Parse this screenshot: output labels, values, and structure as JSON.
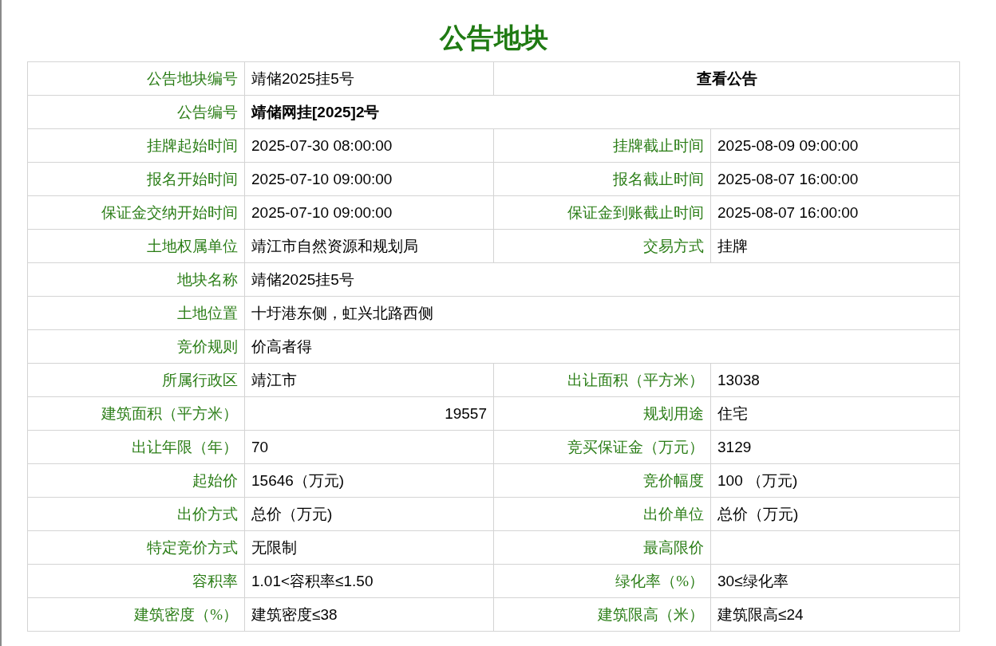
{
  "title": "公告地块",
  "rows": [
    {
      "cells": [
        {
          "kind": "label",
          "text": "公告地块编号"
        },
        {
          "kind": "value",
          "text": "靖储2025挂5号"
        },
        {
          "kind": "link",
          "text": "查看公告"
        }
      ]
    },
    {
      "cells": [
        {
          "kind": "label",
          "text": "公告编号"
        },
        {
          "kind": "value-bold-wide",
          "text": "靖储网挂[2025]2号"
        }
      ]
    },
    {
      "cells": [
        {
          "kind": "label",
          "text": "挂牌起始时间"
        },
        {
          "kind": "value",
          "text": "2025-07-30 08:00:00"
        },
        {
          "kind": "label",
          "text": "挂牌截止时间"
        },
        {
          "kind": "value",
          "text": "2025-08-09 09:00:00"
        }
      ]
    },
    {
      "cells": [
        {
          "kind": "label",
          "text": "报名开始时间"
        },
        {
          "kind": "value",
          "text": "2025-07-10 09:00:00"
        },
        {
          "kind": "label",
          "text": "报名截止时间"
        },
        {
          "kind": "value",
          "text": "2025-08-07 16:00:00"
        }
      ]
    },
    {
      "cells": [
        {
          "kind": "label",
          "text": "保证金交纳开始时间"
        },
        {
          "kind": "value",
          "text": "2025-07-10 09:00:00"
        },
        {
          "kind": "label",
          "text": "保证金到账截止时间"
        },
        {
          "kind": "value",
          "text": "2025-08-07 16:00:00"
        }
      ]
    },
    {
      "cells": [
        {
          "kind": "label",
          "text": "土地权属单位"
        },
        {
          "kind": "value",
          "text": "靖江市自然资源和规划局"
        },
        {
          "kind": "label",
          "text": "交易方式"
        },
        {
          "kind": "value",
          "text": "挂牌"
        }
      ]
    },
    {
      "cells": [
        {
          "kind": "label",
          "text": "地块名称"
        },
        {
          "kind": "value-wide",
          "text": "靖储2025挂5号"
        }
      ]
    },
    {
      "cells": [
        {
          "kind": "label",
          "text": "土地位置"
        },
        {
          "kind": "value-wide",
          "text": "十圩港东侧，虹兴北路西侧"
        }
      ]
    },
    {
      "cells": [
        {
          "kind": "label",
          "text": "竞价规则"
        },
        {
          "kind": "value-wide",
          "text": "价高者得"
        }
      ]
    },
    {
      "cells": [
        {
          "kind": "label",
          "text": "所属行政区"
        },
        {
          "kind": "value",
          "text": "靖江市"
        },
        {
          "kind": "label",
          "text": "出让面积（平方米）"
        },
        {
          "kind": "value",
          "text": "13038"
        }
      ]
    },
    {
      "cells": [
        {
          "kind": "label",
          "text": "建筑面积（平方米）"
        },
        {
          "kind": "value-right",
          "text": "19557"
        },
        {
          "kind": "label",
          "text": "规划用途"
        },
        {
          "kind": "value",
          "text": "住宅"
        }
      ]
    },
    {
      "cells": [
        {
          "kind": "label",
          "text": "出让年限（年）"
        },
        {
          "kind": "value",
          "text": "70"
        },
        {
          "kind": "label",
          "text": "竞买保证金（万元）"
        },
        {
          "kind": "value",
          "text": "3129"
        }
      ]
    },
    {
      "cells": [
        {
          "kind": "label",
          "text": "起始价"
        },
        {
          "kind": "value",
          "text": "15646（万元)"
        },
        {
          "kind": "label",
          "text": "竞价幅度"
        },
        {
          "kind": "value",
          "text": "100 （万元)"
        }
      ]
    },
    {
      "cells": [
        {
          "kind": "label",
          "text": "出价方式"
        },
        {
          "kind": "value",
          "text": "总价（万元)"
        },
        {
          "kind": "label",
          "text": "出价单位"
        },
        {
          "kind": "value",
          "text": "总价（万元)"
        }
      ]
    },
    {
      "cells": [
        {
          "kind": "label",
          "text": "特定竞价方式"
        },
        {
          "kind": "value",
          "text": "无限制"
        },
        {
          "kind": "label",
          "text": "最高限价"
        },
        {
          "kind": "value"
        }
      ]
    },
    {
      "cells": [
        {
          "kind": "label",
          "text": "容积率"
        },
        {
          "kind": "value",
          "text": "1.01<容积率≤1.50"
        },
        {
          "kind": "label",
          "text": "绿化率（%）"
        },
        {
          "kind": "value",
          "text": "30≤绿化率"
        }
      ]
    },
    {
      "cells": [
        {
          "kind": "label",
          "text": "建筑密度（%）"
        },
        {
          "kind": "value",
          "text": "建筑密度≤38"
        },
        {
          "kind": "label",
          "text": "建筑限高（米）"
        },
        {
          "kind": "value",
          "text": "建筑限高≤24"
        }
      ]
    }
  ]
}
